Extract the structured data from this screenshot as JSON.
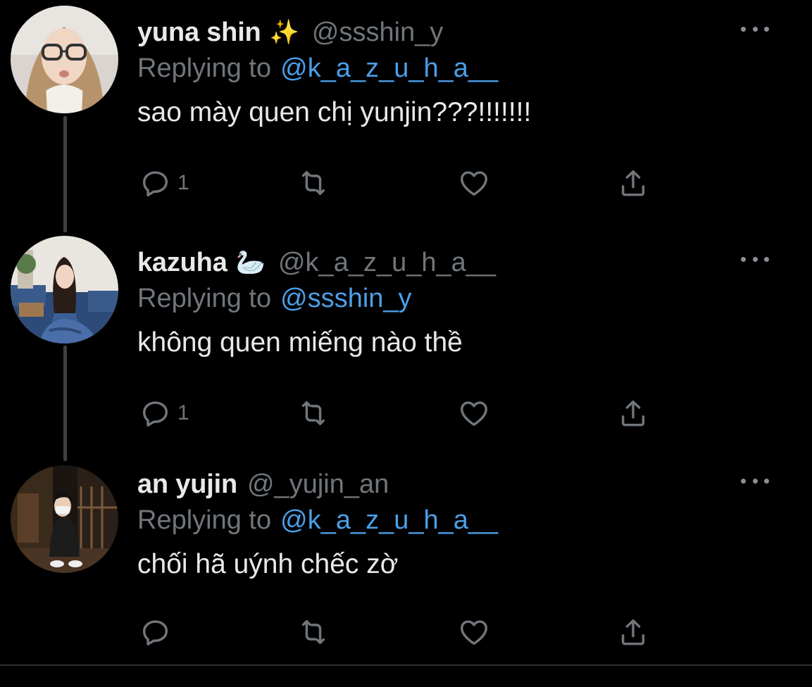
{
  "tweets": [
    {
      "display_name": "yuna shin",
      "emoji": "✨",
      "handle": "@ssshin_y",
      "replying_label": "Replying to",
      "replying_to": "@k_a_z_u_h_a__",
      "text": "sao mày quen chị yunjin???!!!!!!!",
      "reply_count": "1",
      "avatar_icon": "avatar-photo-glasses"
    },
    {
      "display_name": "kazuha",
      "emoji": "🦢",
      "handle": "@k_a_z_u_h_a__",
      "replying_label": "Replying to",
      "replying_to": "@ssshin_y",
      "text": "không quen miếng nào thề",
      "reply_count": "1",
      "avatar_icon": "avatar-photo-denim"
    },
    {
      "display_name": "an yujin",
      "emoji": "",
      "handle": "@_yujin_an",
      "replying_label": "Replying to",
      "replying_to": "@k_a_z_u_h_a__",
      "text": "chối hã uýnh chếc zờ",
      "reply_count": "",
      "avatar_icon": "avatar-photo-crouching"
    }
  ],
  "colors": {
    "background": "#000000",
    "text_primary": "#e7e9ea",
    "text_secondary": "#71767b",
    "link": "#4a9fe8",
    "thread_line": "#3e4144"
  },
  "icons": {
    "reply": "reply-icon",
    "retweet": "retweet-icon",
    "like": "heart-icon",
    "share": "share-icon",
    "more": "more-options-icon"
  }
}
